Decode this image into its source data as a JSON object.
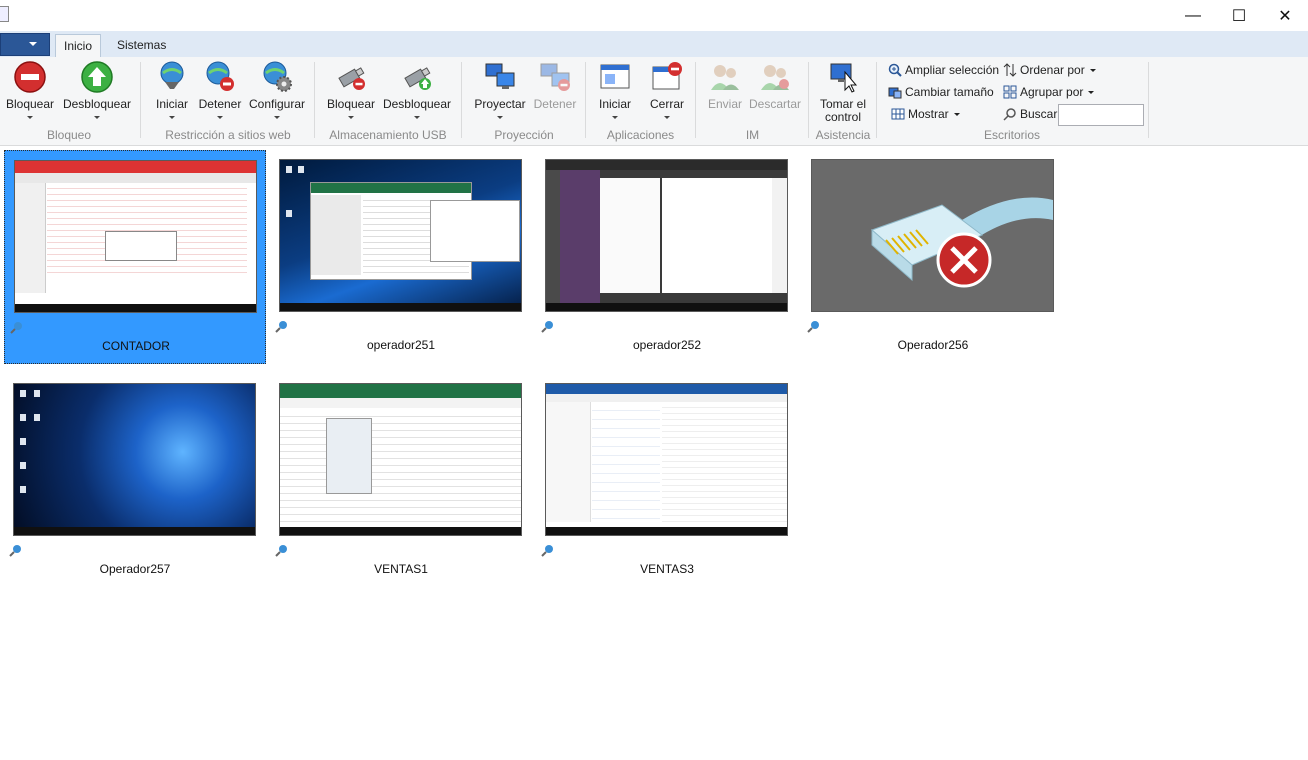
{
  "window": {
    "minimize_glyph": "—",
    "maximize_glyph": "☐",
    "close_glyph": "✕"
  },
  "tabs": [
    {
      "label": "Inicio",
      "active": true
    },
    {
      "label": "Sistemas",
      "active": false
    }
  ],
  "ribbon": {
    "bloqueo": {
      "group_label": "Bloqueo",
      "bloquear": "Bloquear",
      "desbloquear": "Desbloquear"
    },
    "restriccion": {
      "group_label": "Restricción a sitios web",
      "iniciar": "Iniciar",
      "detener": "Detener",
      "configurar": "Configurar"
    },
    "usb": {
      "group_label": "Almacenamiento USB",
      "bloquear": "Bloquear",
      "desbloquear": "Desbloquear"
    },
    "proyeccion": {
      "group_label": "Proyección",
      "proyectar": "Proyectar",
      "detener": "Detener"
    },
    "aplicaciones": {
      "group_label": "Aplicaciones",
      "iniciar": "Iniciar",
      "cerrar": "Cerrar"
    },
    "im": {
      "group_label": "IM",
      "enviar": "Enviar",
      "descartar": "Descartar"
    },
    "asistencia": {
      "group_label": "Asistencia",
      "tomar_line1": "Tomar el",
      "tomar_line2": "control"
    },
    "escritorios": {
      "group_label": "Escritorios",
      "ampliar": "Ampliar selección",
      "cambiar": "Cambiar tamaño",
      "mostrar": "Mostrar",
      "ordenar": "Ordenar por",
      "agrupar": "Agrupar por",
      "buscar": "Buscar",
      "buscar_value": ""
    }
  },
  "computers": [
    {
      "name": "CONTADOR",
      "selected": true
    },
    {
      "name": "operador251",
      "selected": false
    },
    {
      "name": "operador252",
      "selected": false
    },
    {
      "name": "Operador256",
      "selected": false
    },
    {
      "name": "Operador257",
      "selected": false
    },
    {
      "name": "VENTAS1",
      "selected": false
    },
    {
      "name": "VENTAS3",
      "selected": false
    }
  ],
  "colors": {
    "selection": "#3399ff",
    "file_button": "#2b5797",
    "ribbon_bg": "#f5f6f7"
  }
}
